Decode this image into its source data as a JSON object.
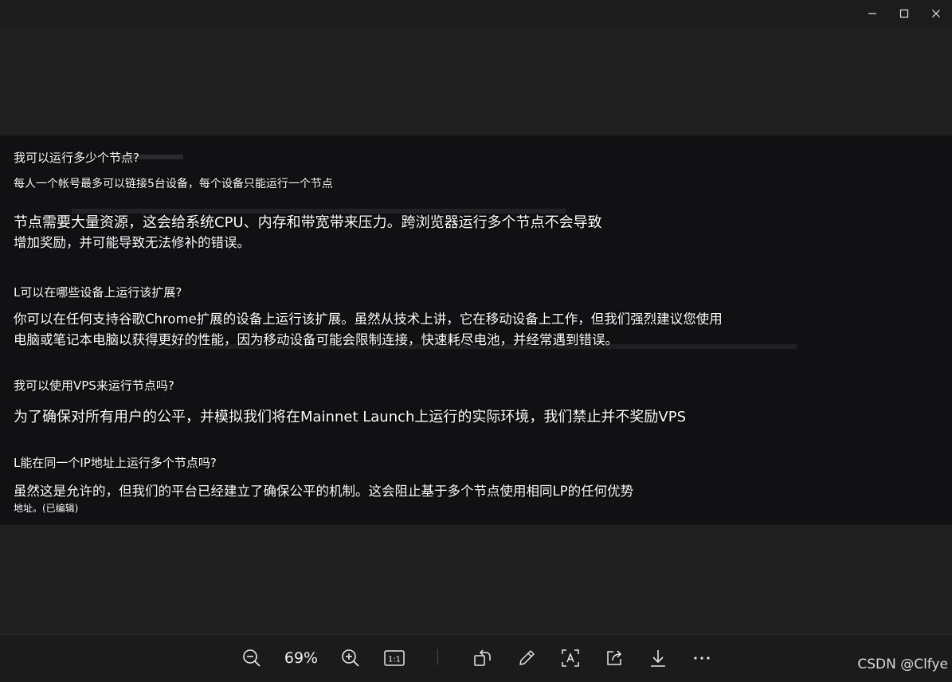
{
  "window": {
    "controls": {
      "minimize": "minimize",
      "maximize": "maximize",
      "close": "close"
    }
  },
  "document": {
    "lines": [
      {
        "text": "我可以运行多少个节点?"
      },
      {
        "text": "每人一个帐号最多可以链接5台设备，每个设备只能运行一个节点"
      },
      {
        "text": "节点需要大量资源，这会给系统CPU、内存和带宽带来压力。跨浏览器运行多个节点不会导致"
      },
      {
        "text": "增加奖励，并可能导致无法修补的错误。"
      },
      {
        "text": "L可以在哪些设备上运行该扩展?"
      },
      {
        "text": "你可以在任何支持谷歌Chrome扩展的设备上运行该扩展。虽然从技术上讲，它在移动设备上工作，但我们强烈建议您使用"
      },
      {
        "text": "电脑或笔记本电脑以获得更好的性能，因为移动设备可能会限制连接，快速耗尽电池，并经常遇到错误。"
      },
      {
        "text": "我可以使用VPS来运行节点吗?"
      },
      {
        "text": "为了确保对所有用户的公平，并模拟我们将在Mainnet Launch上运行的实际环境，我们禁止并不奖励VPS"
      },
      {
        "text": "L能在同一个IP地址上运行多个节点吗?"
      },
      {
        "text": "虽然这是允许的，但我们的平台已经建立了确保公平的机制。这会阻止基于多个节点使用相同LP的任何优势"
      },
      {
        "text": "地址。(已编辑)"
      }
    ]
  },
  "toolbar": {
    "zoom_value": "69%",
    "icons": [
      "zoom-out-icon",
      "zoom-in-icon",
      "actual-size-icon",
      "rotate-icon",
      "edit-icon",
      "ocr-icon",
      "share-icon",
      "download-icon",
      "more-icon"
    ]
  },
  "watermark": {
    "text": "CSDN @Clfye"
  },
  "colors": {
    "background": "#202020",
    "image_background": "#111113",
    "text": "#ffffff"
  }
}
